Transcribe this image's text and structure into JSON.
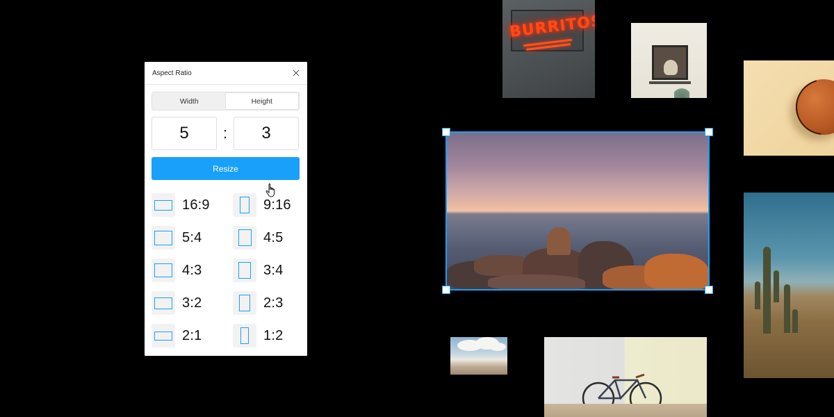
{
  "panel": {
    "title": "Aspect Ratio",
    "close_icon": "close-icon",
    "toggle": [
      {
        "label": "Width",
        "active": false
      },
      {
        "label": "Height",
        "active": true
      }
    ],
    "width_value": "5",
    "height_value": "3",
    "separator": ":",
    "resize_label": "Resize",
    "presets": [
      {
        "label": "16:9",
        "orientation": "landscape"
      },
      {
        "label": "9:16",
        "orientation": "portrait"
      },
      {
        "label": "5:4",
        "orientation": "landscape"
      },
      {
        "label": "4:5",
        "orientation": "portrait"
      },
      {
        "label": "4:3",
        "orientation": "landscape"
      },
      {
        "label": "3:4",
        "orientation": "portrait"
      },
      {
        "label": "3:2",
        "orientation": "landscape"
      },
      {
        "label": "2:3",
        "orientation": "portrait"
      },
      {
        "label": "2:1",
        "orientation": "landscape"
      },
      {
        "label": "1:2",
        "orientation": "portrait"
      }
    ]
  },
  "canvas": {
    "neon_sign_text": "BURRITOS",
    "selected_photo": "sea-sunset-photo"
  },
  "colors": {
    "accent": "#18a0fb",
    "background": "#000000",
    "panel_bg": "#ffffff"
  }
}
